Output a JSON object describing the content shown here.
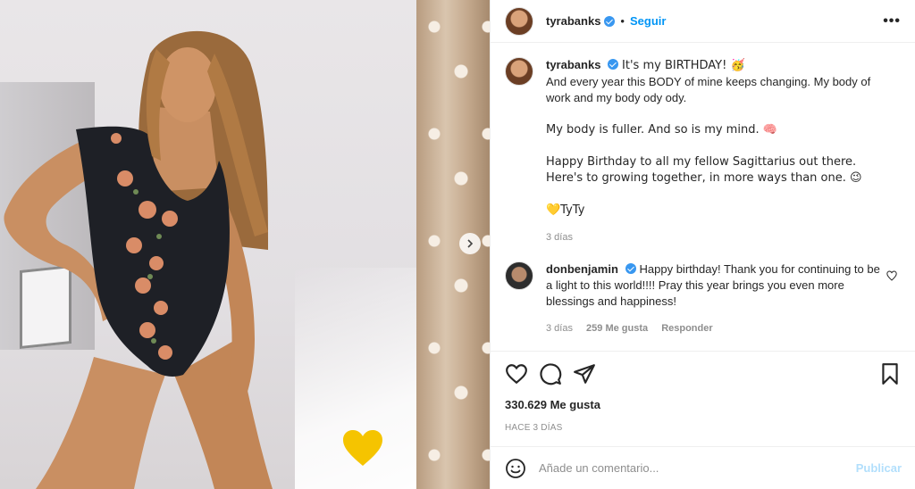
{
  "post": {
    "author": "tyrabanks",
    "follow_label": "Seguir",
    "dot": "•",
    "more": "•••"
  },
  "caption": {
    "username": "tyrabanks",
    "line1": "It's my BIRTHDAY! 🥳",
    "line2": "And every year this BODY of mine keeps changing. My body of work and my body ody ody.",
    "line3": "My body is fuller. And so is my mind. 🧠",
    "line4": "Happy Birthday to all my fellow Sagittarius out there. Here's to growing together, in more ways than one. 😉",
    "line5": "💛TyTy",
    "time": "3 días"
  },
  "comment": {
    "username": "donbenjamin",
    "text": "Happy birthday! Thank you for continuing to be a light to this world!!!! Pray this year brings you even more blessings and happiness!",
    "time": "3 días",
    "likes": "259 Me gusta",
    "reply": "Responder"
  },
  "stats": {
    "likes": "330.629 Me gusta",
    "ago": "HACE 3 DÍAS"
  },
  "add_comment": {
    "placeholder": "Añade un comentario...",
    "publish": "Publicar"
  },
  "icons": {
    "like": "heart-outline-icon",
    "comment": "speech-bubble-icon",
    "share": "paper-plane-icon",
    "save": "bookmark-icon",
    "emoji": "smiley-icon",
    "carousel_next": "chevron-right-icon"
  },
  "colors": {
    "accent": "#0095f6",
    "verified": "#3897f0",
    "publish_disabled": "#b2dffc",
    "muted": "#8e8e8e",
    "sticker_heart": "#f5c400"
  }
}
